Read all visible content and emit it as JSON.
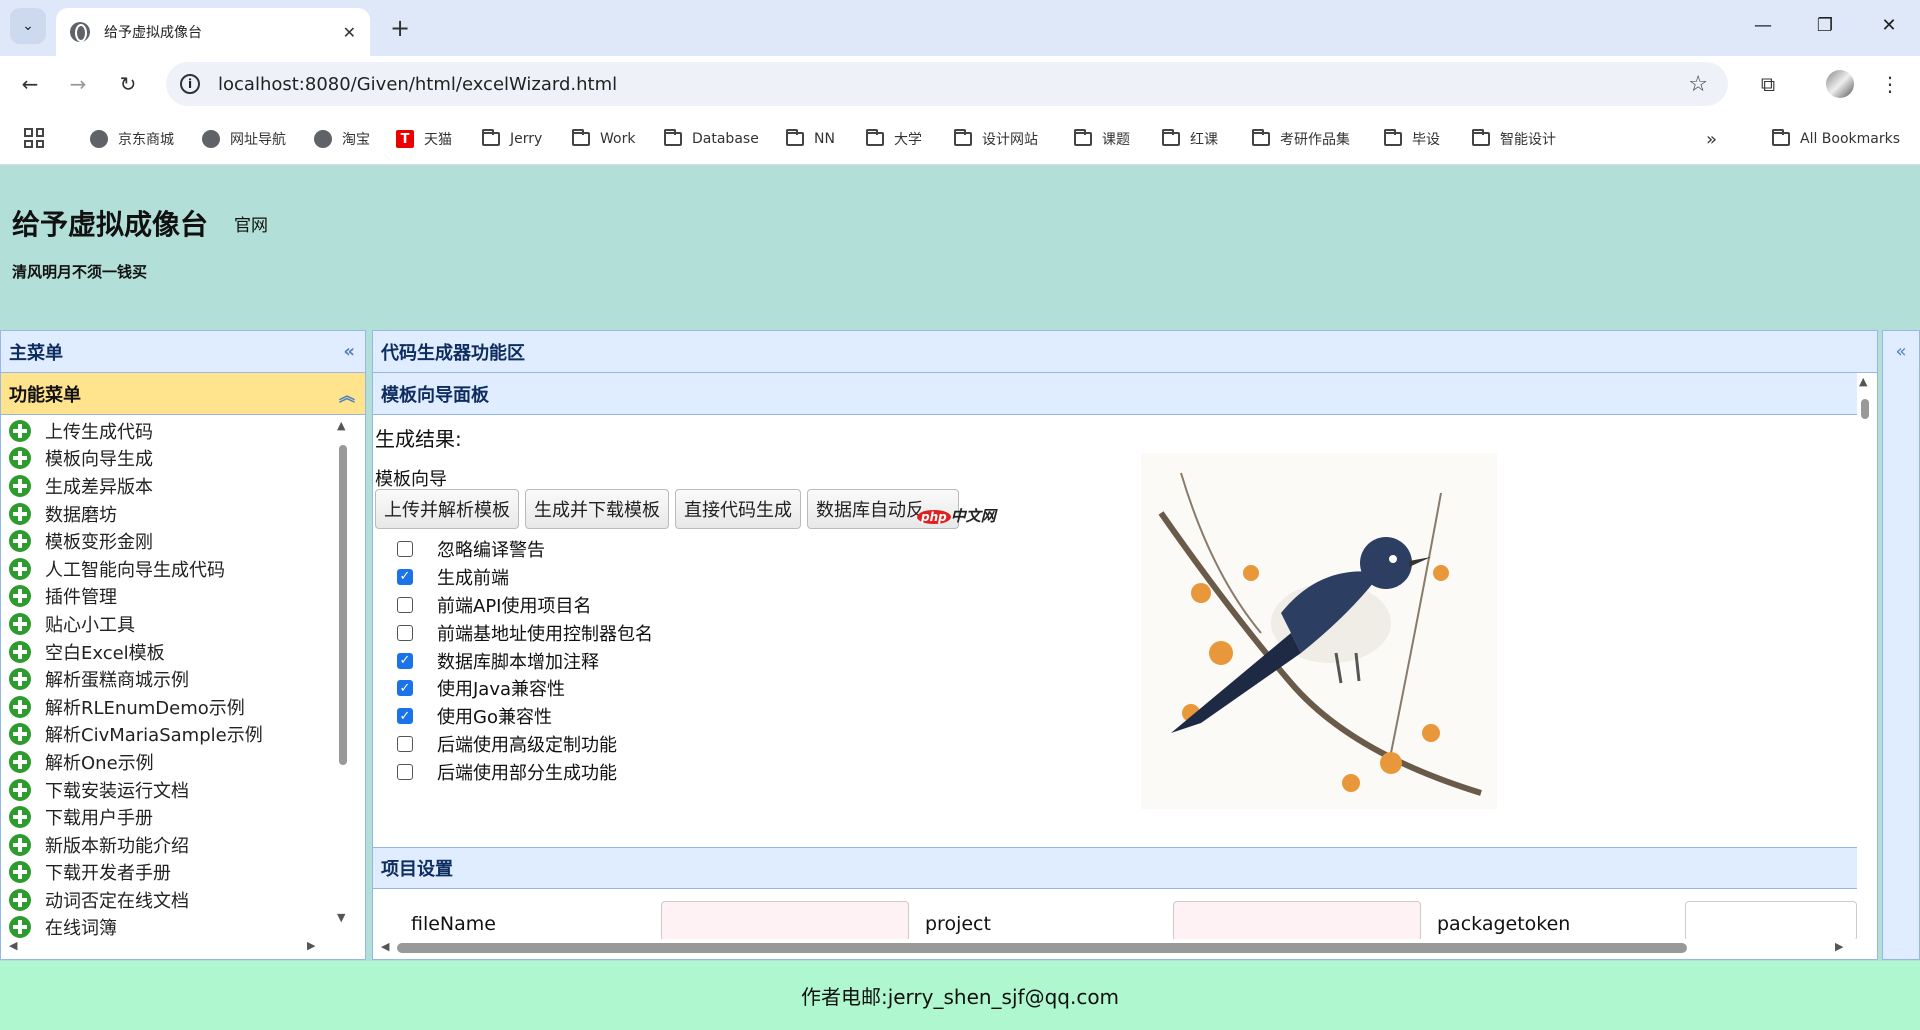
{
  "browser": {
    "tab_title": "给予虚拟成像台",
    "url": "localhost:8080/Given/html/excelWizard.html",
    "bookmarks": [
      "京东商城",
      "网址导航",
      "淘宝",
      "天猫",
      "Jerry",
      "Work",
      "Database",
      "NN",
      "大学",
      "设计网站",
      "课题",
      "红课",
      "考研作品集",
      "毕设",
      "智能设计"
    ],
    "all_bookmarks": "All Bookmarks",
    "tmall_badge": "T"
  },
  "header": {
    "title": "给予虚拟成像台",
    "link": "官网",
    "subtitle": "清风明月不须一钱买"
  },
  "left": {
    "panel_title": "主菜单",
    "accordion_title": "功能菜单",
    "items": [
      "上传生成代码",
      "模板向导生成",
      "生成差异版本",
      "数据磨坊",
      "模板变形金刚",
      "人工智能向导生成代码",
      "插件管理",
      "贴心小工具",
      "空白Excel模板",
      "解析蛋糕商城示例",
      "解析RLEnumDemo示例",
      "解析CivMariaSample示例",
      "解析One示例",
      "下载安装运行文档",
      "下载用户手册",
      "新版本新功能介绍",
      "下载开发者手册",
      "动词否定在线文档",
      "在线词簿"
    ]
  },
  "main": {
    "panel_title": "代码生成器功能区",
    "inner_title": "模板向导面板",
    "result_label": "生成结果:",
    "wizard_label": "模板向导",
    "buttons": [
      "上传并解析模板",
      "生成并下载模板",
      "直接代码生成",
      "数据库自动反"
    ],
    "watermark": "中文网",
    "watermark_badge": "php",
    "checkboxes": [
      {
        "label": "忽略编译警告",
        "checked": false
      },
      {
        "label": "生成前端",
        "checked": true
      },
      {
        "label": "前端API使用项目名",
        "checked": false
      },
      {
        "label": "前端基地址使用控制器包名",
        "checked": false
      },
      {
        "label": "数据库脚本增加注释",
        "checked": true
      },
      {
        "label": "使用Java兼容性",
        "checked": true
      },
      {
        "label": "使用Go兼容性",
        "checked": true
      },
      {
        "label": "后端使用高级定制功能",
        "checked": false
      },
      {
        "label": "后端使用部分生成功能",
        "checked": false
      }
    ],
    "section_title": "项目设置",
    "fields": [
      "fileName",
      "project",
      "packagetoken"
    ]
  },
  "footer": {
    "text": "作者电邮:jerry_shen_sjf@qq.com"
  }
}
